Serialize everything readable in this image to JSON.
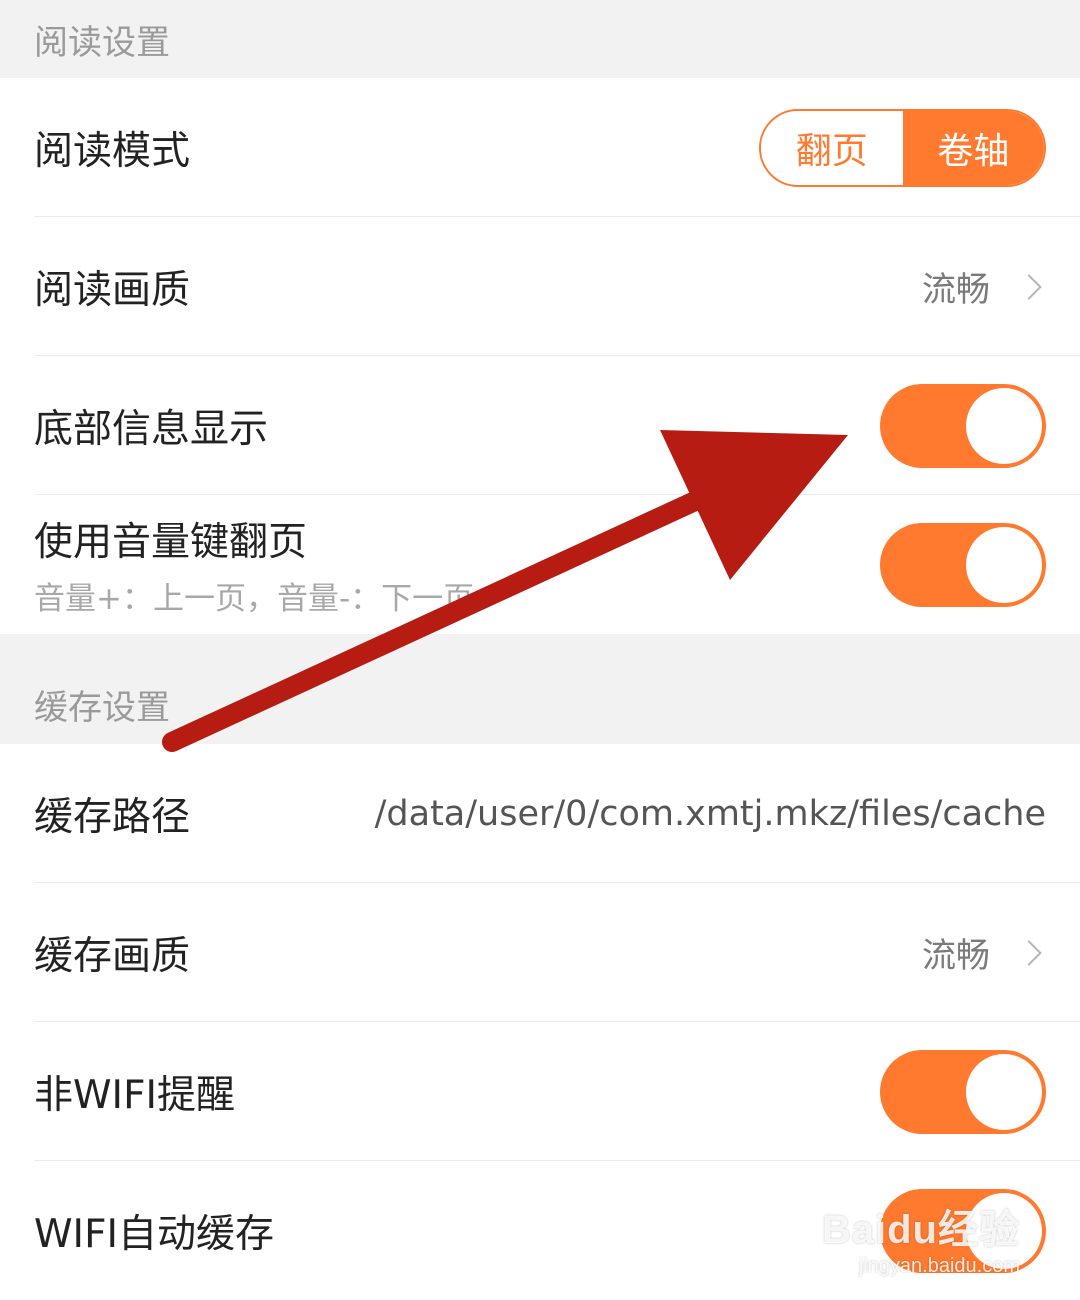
{
  "reading_section": {
    "header": "阅读设置",
    "mode": {
      "label": "阅读模式",
      "options": [
        "翻页",
        "卷轴"
      ],
      "selected": "卷轴"
    },
    "quality": {
      "label": "阅读画质",
      "value": "流畅"
    },
    "bottom_info": {
      "label": "底部信息显示",
      "enabled": true
    },
    "volume_key": {
      "label": "使用音量键翻页",
      "sub": "音量+：上一页，音量-：下一页",
      "enabled": true
    }
  },
  "cache_section": {
    "header": "缓存设置",
    "path": {
      "label": "缓存路径",
      "value": "/data/user/0/com.xmtj.mkz/files/cache"
    },
    "quality": {
      "label": "缓存画质",
      "value": "流畅"
    },
    "non_wifi": {
      "label": "非WIFI提醒",
      "enabled": true
    },
    "wifi_auto": {
      "label": "WIFI自动缓存",
      "enabled": true
    }
  },
  "watermark": {
    "brand": "Baidu经验",
    "url": "jingyan.baidu.com"
  },
  "colors": {
    "accent": "#ff7a2f",
    "annotation_arrow": "#b71c12"
  }
}
